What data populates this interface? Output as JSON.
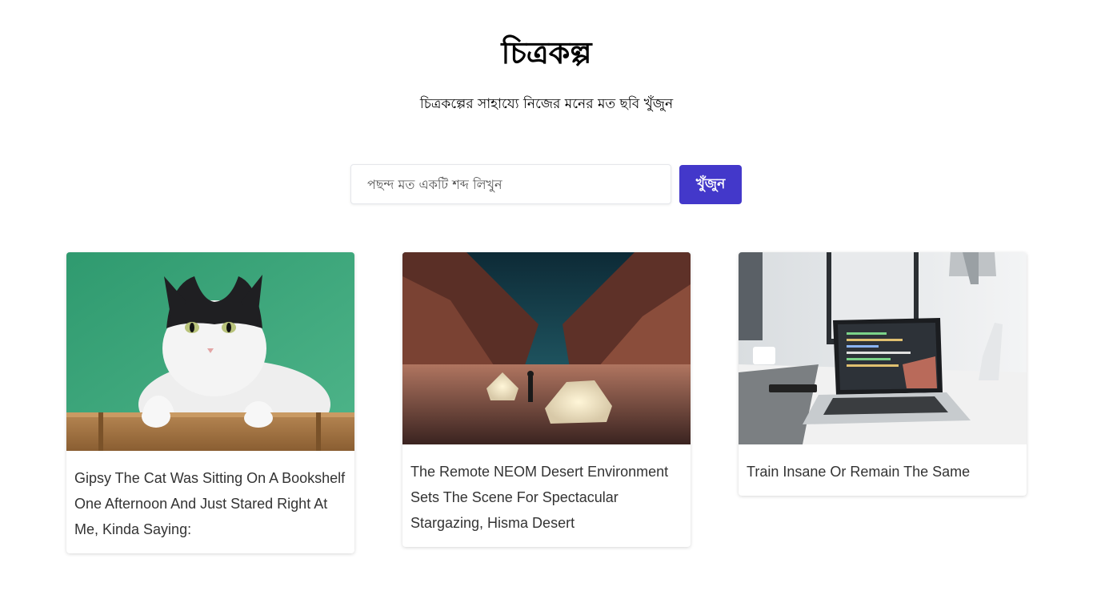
{
  "header": {
    "title": "চিত্রকল্প",
    "subtitle": "চিত্রকল্পের সাহায্যে নিজের মনের মত ছবি খুঁজুন"
  },
  "search": {
    "placeholder": "পছন্দ মত একটি শব্দ লিখুন",
    "value": "",
    "button_label": "খুঁজুন"
  },
  "colors": {
    "accent": "#4338ca"
  },
  "results": [
    {
      "image": "cat-photo",
      "caption": "Gipsy The Cat Was Sitting On A Bookshelf One Afternoon And Just Stared Right At Me, Kinda Saying:"
    },
    {
      "image": "desert-camp-photo",
      "caption": "The Remote NEOM Desert Environment Sets The Scene For Spectacular Stargazing, Hisma Desert"
    },
    {
      "image": "laptop-desk-photo",
      "caption": "Train Insane Or Remain The Same"
    }
  ]
}
